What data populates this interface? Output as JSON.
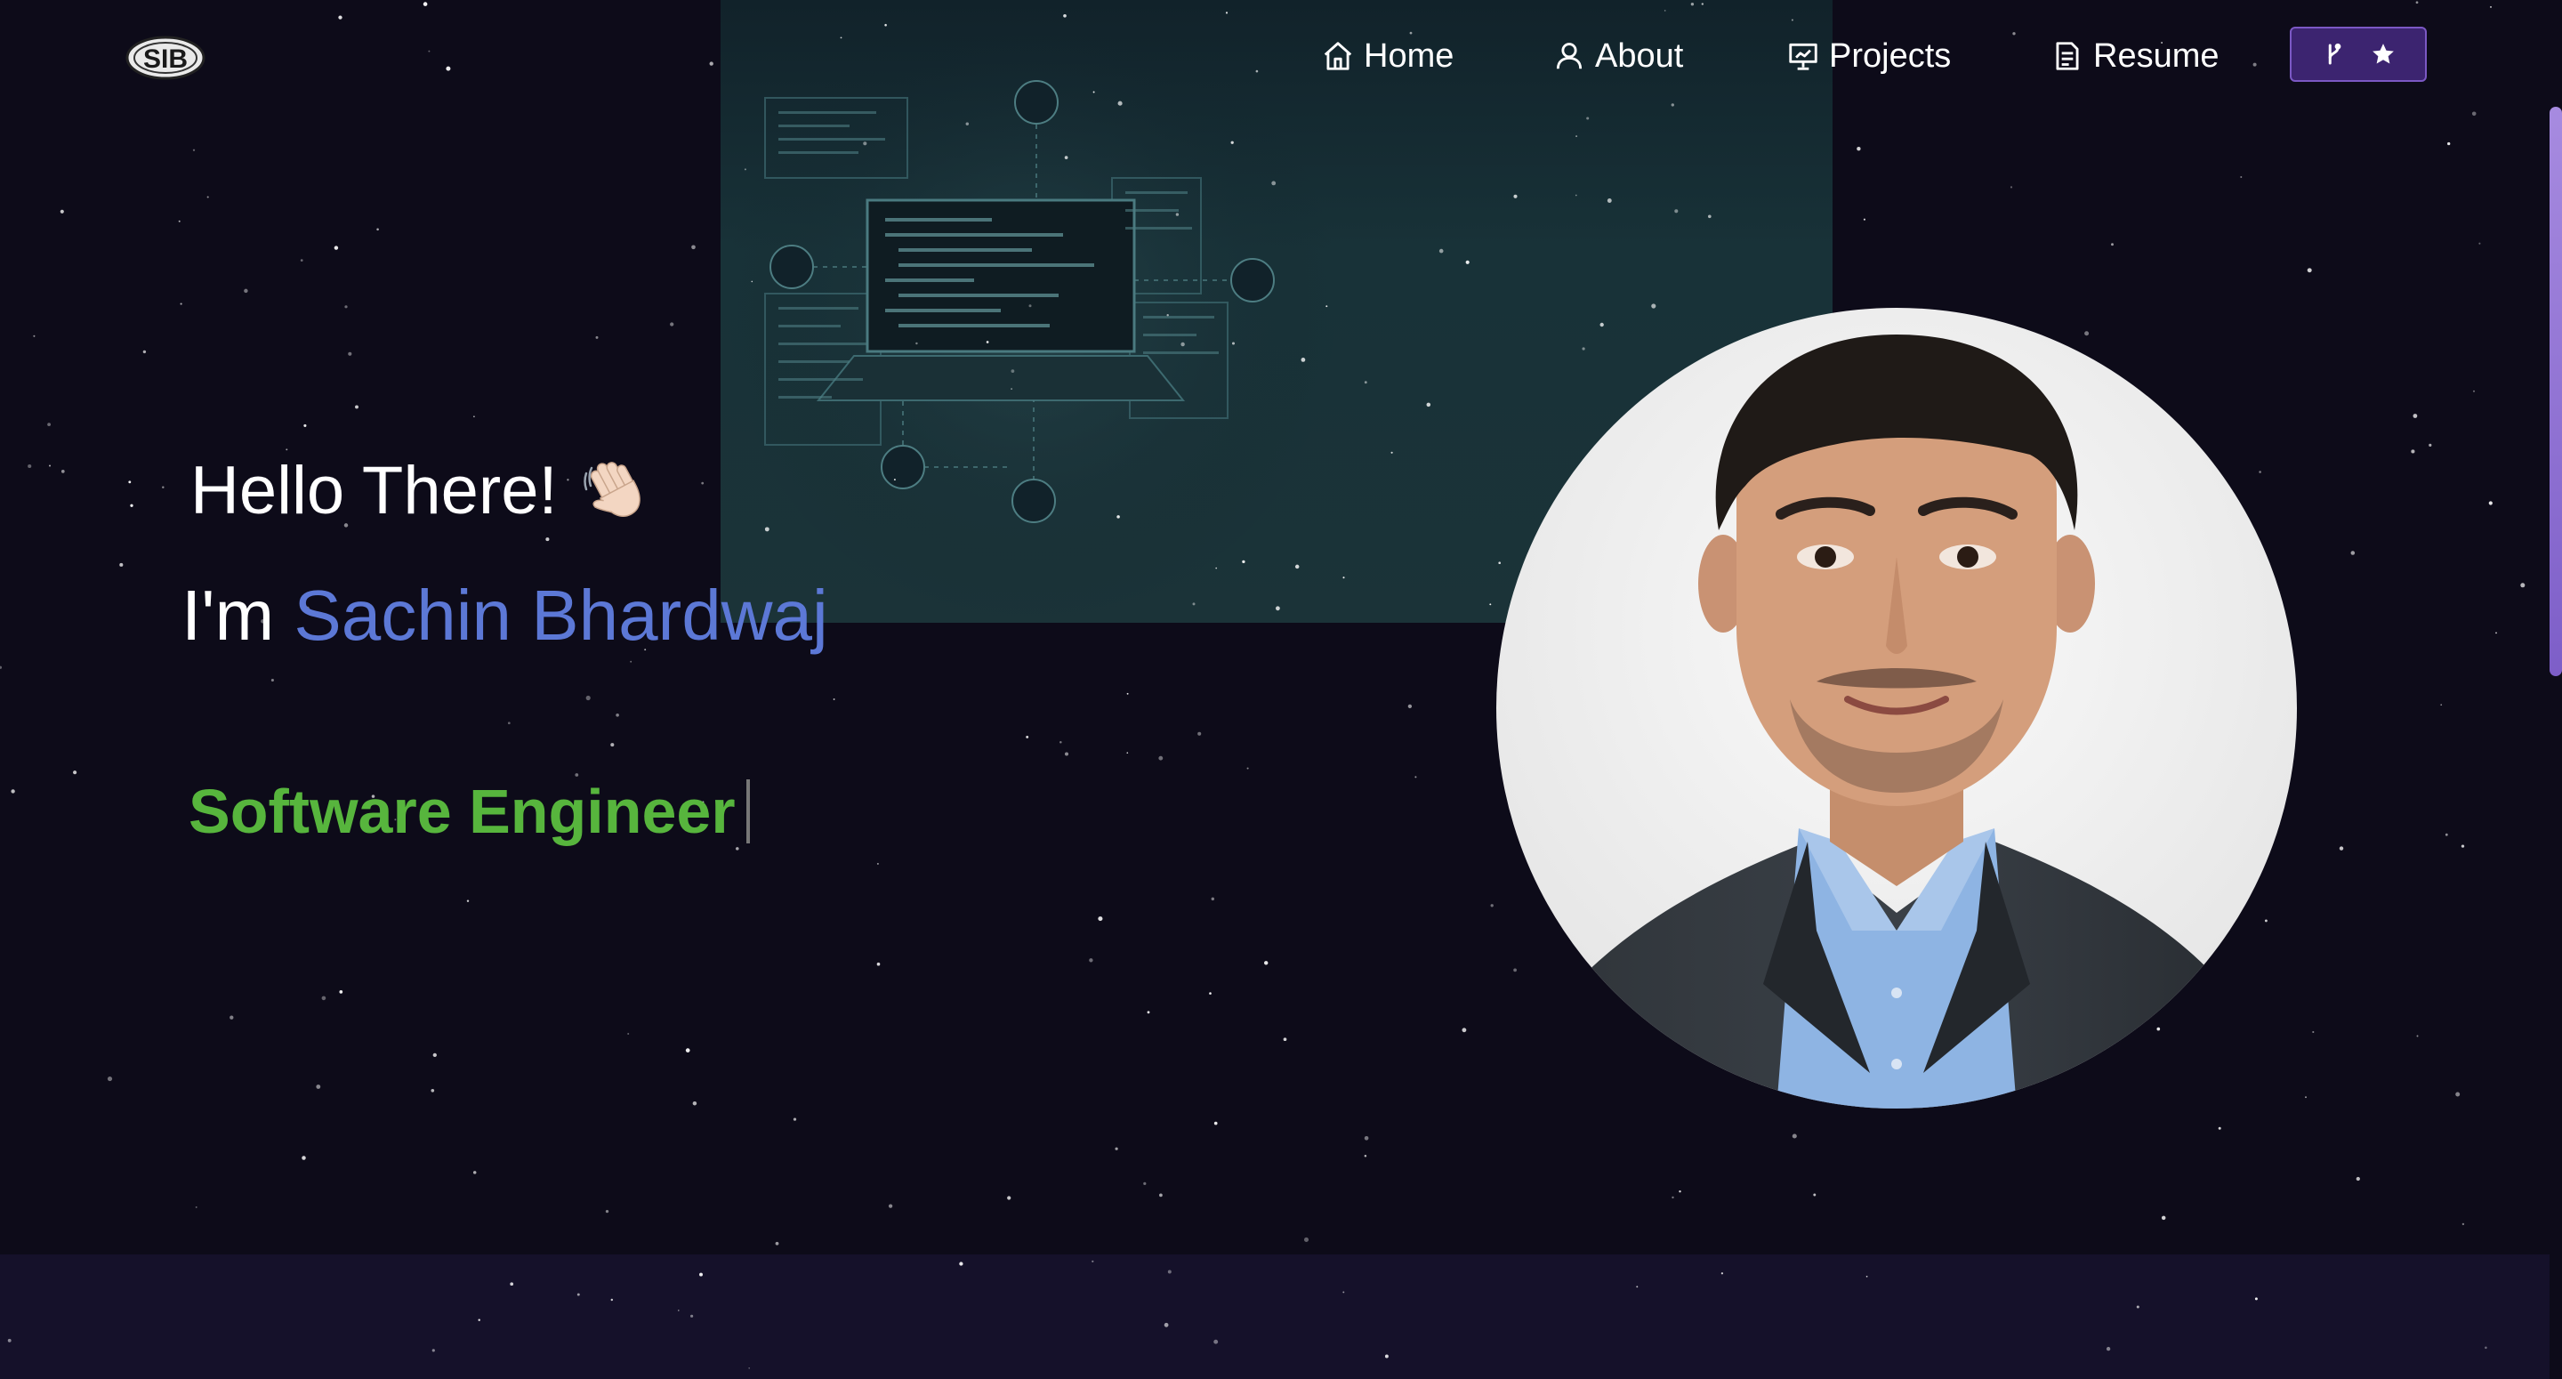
{
  "nav": {
    "logo_text": "SIB",
    "items": [
      {
        "label": "Home",
        "icon": "home-icon"
      },
      {
        "label": "About",
        "icon": "user-icon"
      },
      {
        "label": "Projects",
        "icon": "projects-icon"
      },
      {
        "label": "Resume",
        "icon": "document-icon"
      }
    ],
    "github_button": {
      "icons": [
        "fork-icon",
        "star-icon"
      ]
    }
  },
  "hero": {
    "greeting": "Hello There!",
    "greeting_emoji": "waving-hand-icon",
    "intro_prefix": "I'm ",
    "name": "Sachin Bhardwaj",
    "role": "Software Engineer"
  },
  "avatar": {
    "icon": "profile-photo"
  },
  "colors": {
    "background": "#0d0b19",
    "name_accent": "#5c78d6",
    "role_accent": "#57b53d",
    "button_bg": "#3c2470",
    "button_border": "#7b58c4",
    "scrollbar": "#9a7ddb"
  }
}
